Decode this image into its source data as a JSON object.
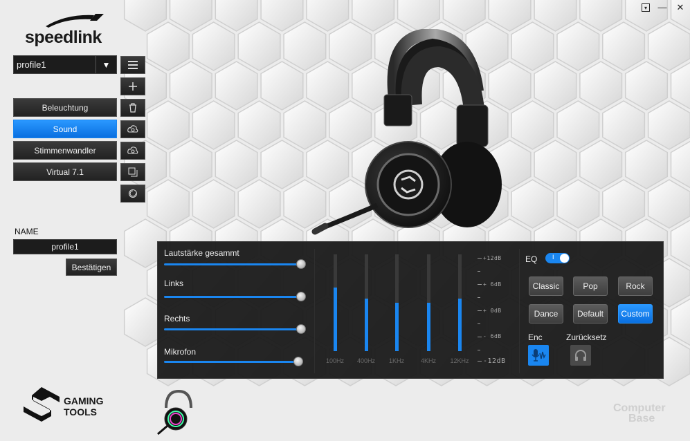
{
  "window": {
    "controls": [
      "▾",
      "—",
      "✕"
    ]
  },
  "brand": {
    "logo_text": "speedlink",
    "gaming_tools_line1": "GAMING",
    "gaming_tools_line2": "TOOLS",
    "watermark_line1": "Computer",
    "watermark_line2": "Base"
  },
  "profile": {
    "selected": "profile1",
    "dropdown_arrow": "▼"
  },
  "nav": {
    "items": [
      {
        "label": "Beleuchtung",
        "active": false
      },
      {
        "label": "Sound",
        "active": true
      },
      {
        "label": "Stimmenwandler",
        "active": false
      },
      {
        "label": "Virtual 7.1",
        "active": false
      }
    ]
  },
  "side_icons": [
    "menu-icon",
    "plus-icon",
    "trash-icon",
    "refresh-icon",
    "refresh-icon",
    "copy-icon",
    "reset-icon"
  ],
  "name_section": {
    "label": "NAME",
    "value": "profile1",
    "confirm_label": "Bestätigen"
  },
  "volume": {
    "sliders": [
      {
        "label": "Lautstärke gesammt",
        "value": 1.0
      },
      {
        "label": "Links",
        "value": 1.0
      },
      {
        "label": "Rechts",
        "value": 1.0
      },
      {
        "label": "Mikrofon",
        "value": 0.98
      }
    ]
  },
  "equalizer": {
    "title": "EQ",
    "enabled": true,
    "toggle_mark": "I",
    "bands": [
      {
        "freq": "100Hz",
        "level": 0.66
      },
      {
        "freq": "400Hz",
        "level": 0.54
      },
      {
        "freq": "1KHz",
        "level": 0.5
      },
      {
        "freq": "4KHz",
        "level": 0.5
      },
      {
        "freq": "12KHz",
        "level": 0.54
      }
    ],
    "scale": [
      "+12dB",
      "+ 6dB",
      "+ 0dB",
      "- 6dB",
      "-12dB"
    ],
    "presets": [
      {
        "label": "Classic",
        "active": false
      },
      {
        "label": "Pop",
        "active": false
      },
      {
        "label": "Rock",
        "active": false
      },
      {
        "label": "Dance",
        "active": false
      },
      {
        "label": "Default",
        "active": false
      },
      {
        "label": "Custom",
        "active": true
      }
    ],
    "enc_label": "Enc",
    "reset_label": "Zurücksetz"
  },
  "colors": {
    "accent": "#1a86f0",
    "panel": "#1c1c1c"
  }
}
